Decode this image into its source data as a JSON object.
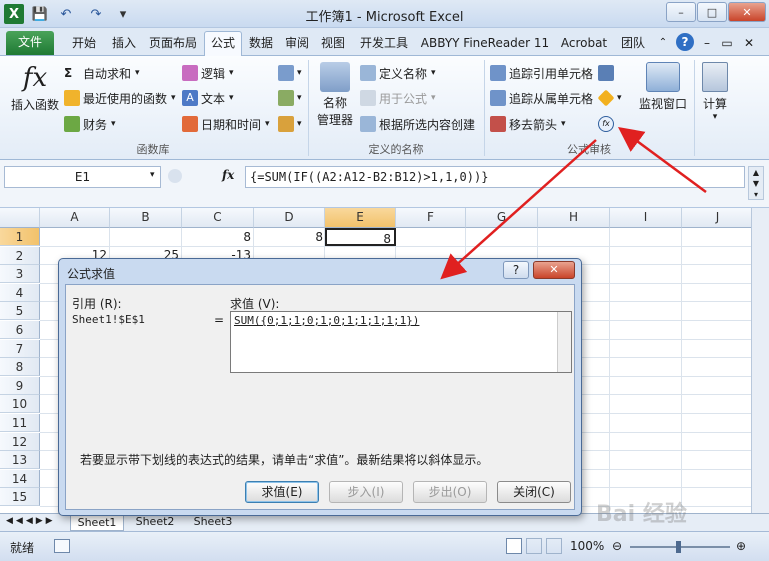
{
  "window": {
    "title": "工作簿1 - Microsoft Excel",
    "min": "–",
    "max": "□",
    "close": "✕"
  },
  "qat": {
    "app_icon": "X",
    "save": "💾",
    "undo": "↶",
    "redo": "↷"
  },
  "tabs": [
    "文件",
    "开始",
    "插入",
    "页面布局",
    "公式",
    "数据",
    "审阅",
    "视图",
    "开发工具",
    "ABBYY FineReader 11",
    "Acrobat",
    "团队"
  ],
  "ribbon": {
    "function_library": {
      "label": "函数库",
      "insert_function": "插入函数",
      "autosum": "自动求和",
      "recent": "最近使用的函数",
      "financial": "财务",
      "logical": "逻辑",
      "text": "文本",
      "datetime": "日期和时间"
    },
    "defined_names": {
      "label": "定义的名称",
      "name_manager_1": "名称",
      "name_manager_2": "管理器",
      "define_name": "定义名称",
      "use_in_formula": "用于公式",
      "create_from_selection": "根据所选内容创建"
    },
    "formula_auditing": {
      "label": "公式审核",
      "trace_precedents": "追踪引用单元格",
      "trace_dependents": "追踪从属单元格",
      "remove_arrows": "移去箭头",
      "watch_window": "监视窗口",
      "calculation": "计算"
    }
  },
  "formula_bar": {
    "name_box": "E1",
    "fx": "fx",
    "formula": "{=SUM(IF((A2:A12-B2:B12)>1,1,0))}"
  },
  "columns": [
    "A",
    "B",
    "C",
    "D",
    "E",
    "F",
    "G",
    "H",
    "I",
    "J"
  ],
  "rows": [
    "1",
    "2",
    "3",
    "4",
    "5",
    "6",
    "7",
    "8",
    "9",
    "10",
    "11",
    "12",
    "13",
    "14",
    "15"
  ],
  "cells": {
    "C1": "8",
    "D1": "8",
    "E1": "8",
    "A2": "12",
    "B2": "25",
    "C2": "-13"
  },
  "sheets": [
    "Sheet1",
    "Sheet2",
    "Sheet3"
  ],
  "status": {
    "ready": "就绪",
    "zoom": "100%"
  },
  "dialog": {
    "title": "公式求值",
    "help": "?",
    "close": "✕",
    "reference_label": "引用 (R):",
    "reference_value": "Sheet1!$E$1",
    "equals": "=",
    "evaluation_label": "求值 (V):",
    "evaluation_value": "SUM({0;1;1;0;1;0;1;1;1;1;1})",
    "hint": "若要显示带下划线的表达式的结果，请单击“求值”。最新结果将以斜体显示。",
    "btn_evaluate": "求值(E)",
    "btn_step_in": "步入(I)",
    "btn_step_out": "步出(O)",
    "btn_close": "关闭(C)"
  },
  "watermark": "Bai 经验",
  "colors": {
    "accent": "#1f7a34",
    "arrow": "#e02020"
  }
}
